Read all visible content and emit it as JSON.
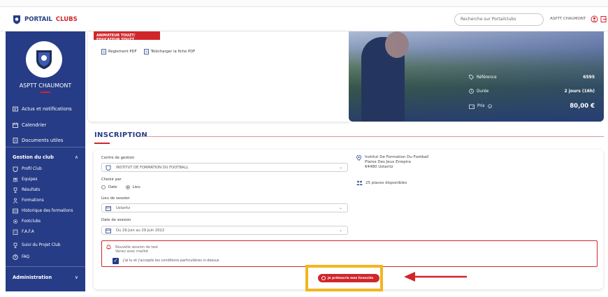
{
  "topbar": {
    "logo_prefix": "PORTAIL",
    "logo_suffix": "CLUBS",
    "search_placeholder": "Recherche sur Portailclubs",
    "user_name": "ASPTT CHAUMONT"
  },
  "sidebar": {
    "club_name": "ASPTT CHAUMONT",
    "items": [
      {
        "label": "Actus et notifications",
        "icon": "newspaper-icon"
      },
      {
        "label": "Calendrier",
        "icon": "calendar-icon"
      },
      {
        "label": "Documents utiles",
        "icon": "document-icon"
      }
    ],
    "group_title": "Gestion du club",
    "group_items": [
      {
        "label": "Profil Club",
        "icon": "shield-icon"
      },
      {
        "label": "Equipes",
        "icon": "team-icon"
      },
      {
        "label": "Résultats",
        "icon": "trophy-icon"
      },
      {
        "label": "Formations",
        "icon": "person-icon"
      },
      {
        "label": "Historique des formations",
        "icon": "list-icon"
      },
      {
        "label": "Footclubs",
        "icon": "gear-icon"
      },
      {
        "label": "F.A.F.A",
        "icon": "building-icon"
      },
      {
        "label": "Suivi du Projet Club",
        "icon": "trophy-icon"
      },
      {
        "label": "FAQ",
        "icon": "help-icon"
      }
    ],
    "admin_title": "Administration"
  },
  "training": {
    "tag": "ANIMATEUR TOUZT/ EDUCATEUR TOUZT",
    "doc_links": [
      "Règlement PDF",
      "Télécharger la fiche PDF"
    ],
    "reference_label": "Référence",
    "reference_value": "6595",
    "duration_label": "Durée",
    "duration_value": "2 jours (16h)",
    "price_label": "Prix",
    "price_value": "80,00 €"
  },
  "inscription": {
    "title": "INSCRIPTION",
    "center_label": "Centre de gestion",
    "center_value": "INSTITUT DE FORMATION DU FOOTBALL",
    "choose_label": "Choisir par",
    "radio_options": [
      "Date",
      "Lieu"
    ],
    "radio_selected": "Lieu",
    "place_label": "Lieu de session",
    "place_value": "Ustaritz",
    "date_label": "Date de session",
    "date_value": "Du 29 Juin au 29 Juin 2022",
    "location_name": "Institut De Formation Du Football",
    "location_street": "Plaine Des Jeux Errepira",
    "location_city": "64480 Ustaritz",
    "places": "25 places disponibles",
    "alert_line1": "Nouvelle session de test",
    "alert_line2": "Venez avec maillot",
    "accept_text": "J'ai lu et j'accepte les conditions particulières ci-dessus",
    "submit_label": "Je préinscris mes licenciés"
  },
  "colors": {
    "brand_blue": "#263c86",
    "brand_red": "#d0262a",
    "highlight": "#f2b61f"
  }
}
